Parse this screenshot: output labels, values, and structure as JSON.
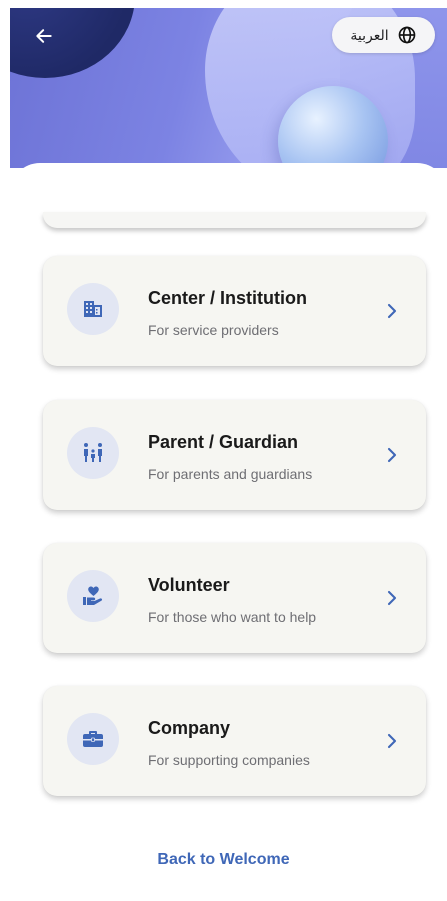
{
  "header": {
    "back_icon": "arrow-left-icon",
    "language_button": {
      "label": "العربية",
      "icon": "globe-icon"
    }
  },
  "options": [
    {
      "title": "Center / Institution",
      "subtitle": "For service providers",
      "icon": "building-icon"
    },
    {
      "title": "Parent / Guardian",
      "subtitle": "For parents and guardians",
      "icon": "family-icon"
    },
    {
      "title": "Volunteer",
      "subtitle": "For those who want to help",
      "icon": "volunteer-heart-hand-icon"
    },
    {
      "title": "Company",
      "subtitle": "For supporting companies",
      "icon": "briefcase-icon"
    }
  ],
  "footer": {
    "back_link": "Back to Welcome"
  },
  "colors": {
    "accent": "#3f67b7",
    "icon_color": "#3f67b7",
    "card_bg": "#f6f6f2",
    "icon_circle_bg": "#e2e6f3"
  }
}
